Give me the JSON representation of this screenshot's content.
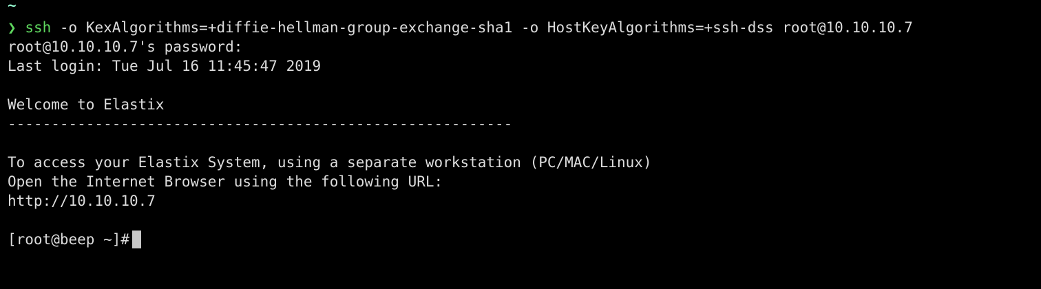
{
  "terminal": {
    "cwd_line": "~",
    "prompt_glyph": "❯",
    "command": {
      "program": "ssh",
      "args": " -o KexAlgorithms=+diffie-hellman-group-exchange-sha1 -o HostKeyAlgorithms=+ssh-dss root@10.10.10.7"
    },
    "output": {
      "password_prompt": "root@10.10.10.7's password:",
      "last_login": "Last login: Tue Jul 16 11:45:47 2019",
      "welcome": "Welcome to Elastix",
      "separator": "----------------------------------------------------------",
      "access_line": "To access your Elastix System, using a separate workstation (PC/MAC/Linux)",
      "browser_line": "Open the Internet Browser using the following URL:",
      "url": "http://10.10.10.7"
    },
    "remote_prompt": "[root@beep ~]#"
  },
  "colors": {
    "background": "#000000",
    "text": "#dcdcdc",
    "accent_green": "#5fd75f",
    "cursor": "#c8c8c8"
  }
}
